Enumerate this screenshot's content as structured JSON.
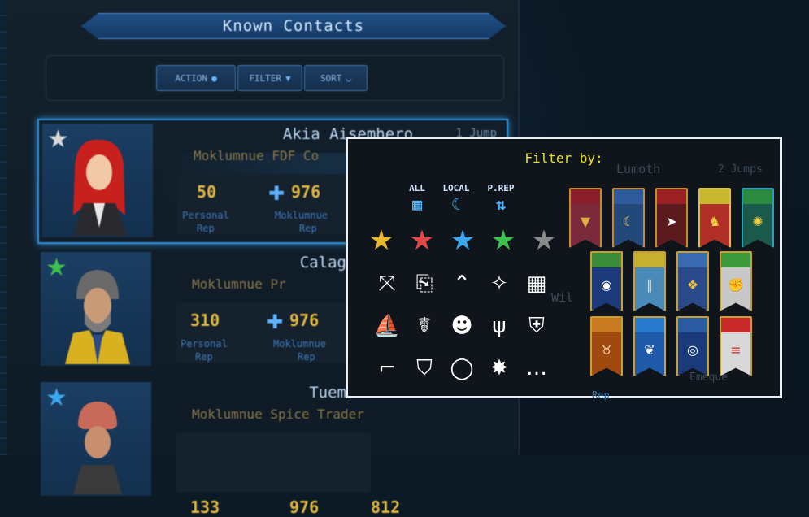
{
  "window": {
    "title": "Known Contacts"
  },
  "toolbar": {
    "action": "ACTION",
    "filter": "FILTER",
    "sort": "SORT"
  },
  "contacts": [
    {
      "name": "Akia Aisemhero",
      "jump": "1 Jump",
      "org": "Moklumnue FDF Co",
      "personal": "50",
      "faction": "976",
      "personal_label": "Personal",
      "rep_label": "Rep",
      "faction_label": "Moklumnue",
      "star": "white",
      "selected": true
    },
    {
      "name": "Calagan Fa",
      "org": "Moklumnue Pr",
      "personal": "310",
      "faction": "976",
      "personal_label": "Personal",
      "rep_label": "Rep",
      "faction_label": "Moklumnue",
      "star": "green"
    },
    {
      "name": "Tuemette",
      "org": "Moklumnue Spice Trader",
      "personal": "133",
      "faction": "976",
      "extra": "812",
      "star": "blue"
    }
  ],
  "filter": {
    "title": "Filter by:",
    "categories": [
      {
        "label": "ALL",
        "icon": "grid-icon"
      },
      {
        "label": "LOCAL",
        "icon": "moon-icon"
      },
      {
        "label": "P.REP",
        "icon": "arrows-updown-icon"
      }
    ],
    "stars": [
      {
        "color": "#e8b830",
        "name": "gold-star"
      },
      {
        "color": "#e04848",
        "name": "red-star"
      },
      {
        "color": "#3aa8f0",
        "name": "blue-star"
      },
      {
        "color": "#3cc050",
        "name": "green-star"
      },
      {
        "color": "#8a8a8a",
        "name": "gray-star"
      }
    ],
    "roles": [
      {
        "name": "crossroads-icon",
        "glyph": "⤧"
      },
      {
        "name": "certificate-icon",
        "glyph": "⎘"
      },
      {
        "name": "chevron-rank-icon",
        "glyph": "⌃"
      },
      {
        "name": "compass-icon",
        "glyph": "✧"
      },
      {
        "name": "chip-icon",
        "glyph": "▦"
      },
      {
        "name": "ship-icon",
        "glyph": "⛵"
      },
      {
        "name": "bug-icon",
        "glyph": "☤"
      },
      {
        "name": "group-add-icon",
        "glyph": "☻"
      },
      {
        "name": "trident-icon",
        "glyph": "ψ"
      },
      {
        "name": "shield-wing-icon",
        "glyph": "⛨"
      },
      {
        "name": "rifle-icon",
        "glyph": "⌐"
      },
      {
        "name": "armor-icon",
        "glyph": "⛉"
      },
      {
        "name": "ring-icon",
        "glyph": "◯"
      },
      {
        "name": "burst-icon",
        "glyph": "✸"
      },
      {
        "name": "chat-icon",
        "glyph": "…"
      }
    ],
    "behind_text": {
      "name": "Lumoth",
      "jump": "2 Jumps",
      "sub": "Wil",
      "rep": "Rep",
      "extra": "Emeque"
    },
    "banners": [
      {
        "name": "banner-triangle",
        "bg": "#7a2a3a",
        "border": "#c88a2a",
        "drape": "#8a1e2a",
        "emblem": "▼",
        "emcolor": "#e0b040"
      },
      {
        "name": "banner-moon",
        "bg": "#23487a",
        "border": "#c88a2a",
        "drape": "#2c5a9a",
        "emblem": "☾",
        "emcolor": "#f0d050"
      },
      {
        "name": "banner-bird",
        "bg": "#5a1a1e",
        "border": "#c88a2a",
        "drape": "#9a2024",
        "emblem": "➤",
        "emcolor": "#ffffff"
      },
      {
        "name": "banner-lion",
        "bg": "#b03028",
        "border": "#d8c040",
        "drape": "#c8b830",
        "emblem": "♞",
        "emcolor": "#f0d040"
      },
      {
        "name": "banner-sun",
        "bg": "#1a5a4a",
        "border": "#2aa0c0",
        "drape": "#2a8a40",
        "emblem": "✺",
        "emcolor": "#f0d040"
      },
      {
        "name": "banner-eye",
        "bg": "#1c3a7a",
        "border": "#c8a030",
        "drape": "#3a8a3a",
        "emblem": "◉",
        "emcolor": "#ffffff"
      },
      {
        "name": "banner-pillar",
        "bg": "#4a8ab8",
        "border": "#c8a030",
        "drape": "#c8b030",
        "emblem": "∥",
        "emcolor": "#e0e0e0"
      },
      {
        "name": "banner-wings",
        "bg": "#2a4a8a",
        "border": "#c8a030",
        "drape": "#3a6ab0",
        "emblem": "❖",
        "emcolor": "#f0c040"
      },
      {
        "name": "banner-fist",
        "bg": "#c8c8c8",
        "border": "#c8a030",
        "drape": "#3a9a3a",
        "emblem": "✊",
        "emcolor": "#d8b030"
      },
      {
        "name": "banner-hoof",
        "bg": "#a04a10",
        "border": "#c8a030",
        "drape": "#c87a20",
        "emblem": "♉",
        "emcolor": "#f0d0a0"
      },
      {
        "name": "banner-feather",
        "bg": "#1e5aa8",
        "border": "#c8a030",
        "drape": "#2a7ad0",
        "emblem": "❦",
        "emcolor": "#ffffff"
      },
      {
        "name": "banner-orb",
        "bg": "#1a3a7a",
        "border": "#c8a030",
        "drape": "#2a5aa0",
        "emblem": "◎",
        "emcolor": "#ffffff"
      },
      {
        "name": "banner-ladder",
        "bg": "#d8d8d8",
        "border": "#c8a030",
        "drape": "#c82a2a",
        "emblem": "≡",
        "emcolor": "#c82a2a"
      }
    ]
  }
}
